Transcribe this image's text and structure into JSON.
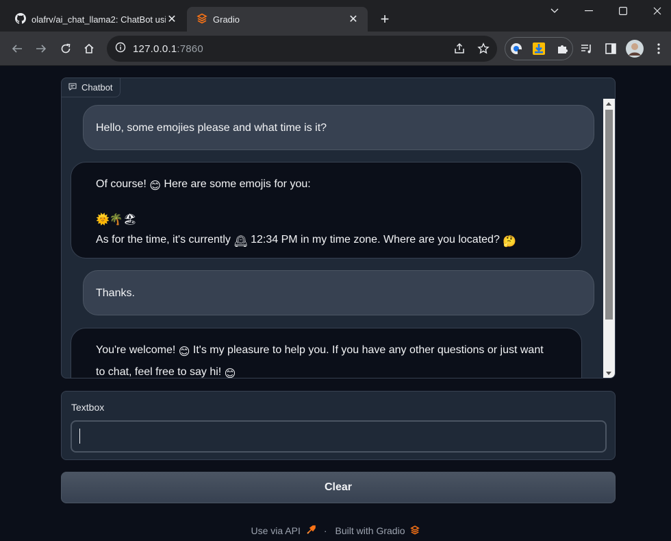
{
  "browser": {
    "tabs": [
      {
        "title": "olafrv/ai_chat_llama2: ChatBot using",
        "icon": "github-icon",
        "active": false
      },
      {
        "title": "Gradio",
        "icon": "gradio-icon",
        "active": true
      }
    ],
    "url_host": "127.0.0.1",
    "url_port": ":7860"
  },
  "chatbot": {
    "label": "Chatbot",
    "messages": [
      {
        "role": "user",
        "lines": [
          "Hello, some emojies please and what time is it?"
        ]
      },
      {
        "role": "bot",
        "line1_a": "Of course! ",
        "line1_emoji": "😊",
        "line1_b": " Here are some emojis for you:",
        "line2_emojis": "🌞🌴🏖",
        "line3_a": "As for the time, it's currently ",
        "line3_emoji": "🕰",
        "line3_b": " 12:34 PM in my time zone. Where are you located? ",
        "line3_emoji2": "🤔"
      },
      {
        "role": "user",
        "lines": [
          "Thanks."
        ]
      },
      {
        "role": "bot",
        "line1_a": "You're welcome! ",
        "line1_emoji": "😊",
        "line1_b": " It's my pleasure to help you. If you have any other questions or just want",
        "line2_a": "to chat, feel free to say hi! ",
        "line2_emoji": "😊"
      }
    ]
  },
  "textbox": {
    "label": "Textbox",
    "value": ""
  },
  "clear_button": {
    "label": "Clear"
  },
  "footer": {
    "api_label": "Use via API",
    "separator": "·",
    "built_label": "Built with Gradio"
  }
}
